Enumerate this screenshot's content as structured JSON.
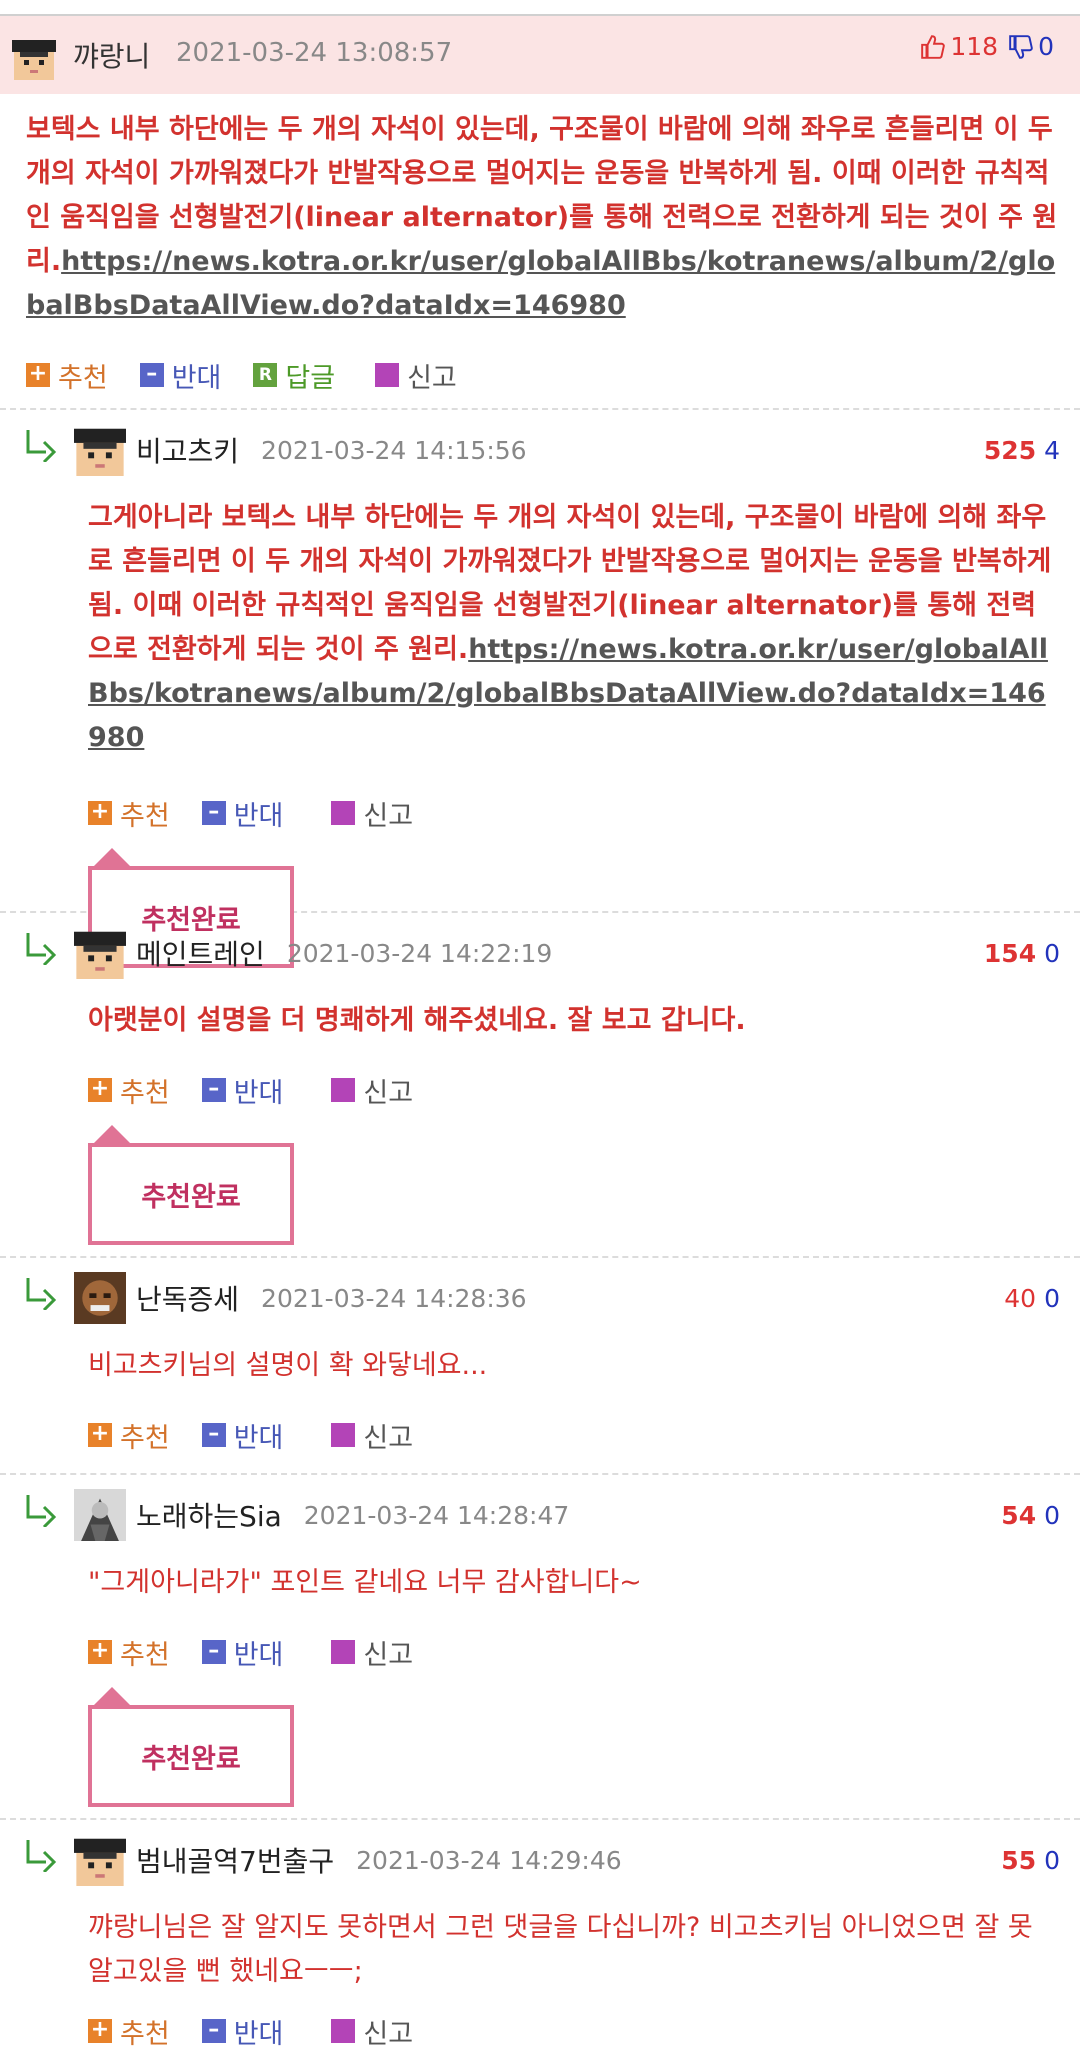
{
  "post": {
    "author": "꺄랑니",
    "date": "2021-03-24 13:08:57",
    "likes": "118",
    "dislikes": "0",
    "text": "보텍스 내부 하단에는 두 개의 자석이 있는데, 구조물이 바람에 의해 좌우로 흔들리면 이 두 개의 자석이 가까워졌다가 반발작용으로 멀어지는 운동을 반복하게 됨. 이때 이러한 규칙적인 움직임을 선형발전기(linear alternator)를 통해 전력으로 전환하게 되는 것이 주 원리.",
    "link": "https://news.kotra.or.kr/user/globalAllBbs/kotranews/album/2/globalBbsDataAllView.do?dataIdx=146980",
    "actions": {
      "up": "추천",
      "down": "반대",
      "reply": "답글",
      "report": "신고"
    }
  },
  "actions": {
    "up": "추천",
    "down": "반대",
    "report": "신고",
    "done": "추천완료"
  },
  "comments": [
    {
      "author": "비고츠키",
      "date": "2021-03-24 14:15:56",
      "up": "525",
      "down": "4",
      "text": "그게아니라 보텍스 내부 하단에는 두 개의 자석이 있는데, 구조물이 바람에 의해 좌우로 흔들리면 이 두 개의 자석이 가까워졌다가 반발작용으로 멀어지는 운동을 반복하게 됨. 이때 이러한 규칙적인 움직임을 선형발전기(linear alternator)를 통해 전력으로 전환하게 되는 것이 주 원리.",
      "link": "https://news.kotra.or.kr/user/globalAllBbs/kotranews/album/2/globalBbsDataAllView.do?dataIdx=146980"
    },
    {
      "author": "메인트레인",
      "date": "2021-03-24 14:22:19",
      "up": "154",
      "down": "0",
      "text": "아랫분이 설명을 더 명쾌하게 해주셨네요. 잘 보고 갑니다."
    },
    {
      "author": "난독증세",
      "date": "2021-03-24 14:28:36",
      "up": "40",
      "down": "0",
      "text": "비고츠키님의 설명이 확 와닿네요..."
    },
    {
      "author": "노래하는Sia",
      "date": "2021-03-24 14:28:47",
      "up": "54",
      "down": "0",
      "text": "\"그게아니라가\" 포인트 같네요 너무 감사합니다~"
    },
    {
      "author": "범내골역7번출구",
      "date": "2021-03-24 14:29:46",
      "up": "55",
      "down": "0",
      "text": "꺄랑니님은 잘 알지도 못하면서 그런 댓글을 다십니까? 비고츠키님 아니었으면 잘 못 알고있을 뻔 했네요ㅡㅡ;"
    }
  ]
}
